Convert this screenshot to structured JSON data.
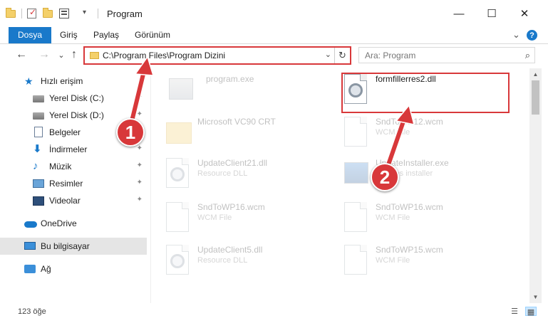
{
  "window": {
    "title": "Program",
    "minimize_label": "—",
    "maximize_label": "☐",
    "close_label": "✕"
  },
  "quick_access_toolbar": {
    "dropdown_glyph": "▾",
    "separator": "|"
  },
  "ribbon": {
    "tabs": [
      "Dosya",
      "Giriş",
      "Paylaş",
      "Görünüm"
    ],
    "expand_glyph": "⌄",
    "help_glyph": "?"
  },
  "navigation": {
    "back_glyph": "←",
    "forward_glyph": "→",
    "recent_glyph": "⌄",
    "up_glyph": "↑",
    "address": "C:\\Program Files\\Program Dizini",
    "address_dropdown_glyph": "⌄",
    "refresh_glyph": "↻",
    "search_placeholder": "Ara: Program",
    "search_glyph": "⌕"
  },
  "sidebar": {
    "pin_glyph": "✦",
    "items": [
      {
        "label": "Hızlı erişim",
        "icon": "star-icon"
      },
      {
        "label": "Yerel Disk (C:)",
        "icon": "drive-icon"
      },
      {
        "label": "Yerel Disk (D:)",
        "icon": "drive-icon"
      },
      {
        "label": "Belgeler",
        "icon": "document-icon"
      },
      {
        "label": "İndirmeler",
        "icon": "download-icon"
      },
      {
        "label": "Müzik",
        "icon": "music-icon"
      },
      {
        "label": "Resimler",
        "icon": "pictures-icon"
      },
      {
        "label": "Videolar",
        "icon": "video-icon"
      },
      {
        "label": "OneDrive",
        "icon": "cloud-icon"
      },
      {
        "label": "Bu bilgisayar",
        "icon": "computer-icon"
      },
      {
        "label": "Ağ",
        "icon": "network-icon"
      }
    ],
    "star_glyph": "★",
    "download_glyph": "⬇",
    "music_glyph": "♪"
  },
  "files": [
    {
      "name": "program.exe",
      "type": ""
    },
    {
      "name": "formfillerres2.dll",
      "type": ""
    },
    {
      "name": "Microsoft VC90 CRT",
      "type": ""
    },
    {
      "name": "SndToWP12.wcm",
      "type": "WCM File"
    },
    {
      "name": "UpdateClient21.dll",
      "type": "Resource DLL"
    },
    {
      "name": "UpdateInstaller.exe",
      "type": "updates installer"
    },
    {
      "name": "SndToWP16.wcm",
      "type": "WCM File"
    },
    {
      "name": "SndToWP16.wcm",
      "type": "WCM File"
    },
    {
      "name": "UpdateClient5.dll",
      "type": "Resource DLL"
    },
    {
      "name": "SndToWP15.wcm",
      "type": "WCM File"
    }
  ],
  "callouts": [
    "1",
    "2"
  ],
  "scrollbar": {
    "up_glyph": "▲",
    "down_glyph": "▼"
  },
  "status": {
    "item_count": "123 öğe",
    "details_view_glyph": "☰",
    "icons_view_glyph": "▦"
  },
  "colors": {
    "accent": "#1979ca",
    "highlight_red": "#d8383a",
    "selection": "#cce8ff"
  }
}
